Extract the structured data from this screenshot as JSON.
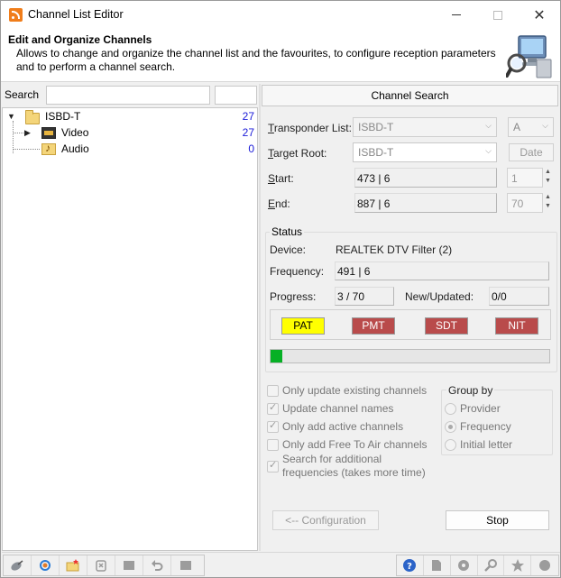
{
  "window": {
    "title": "Channel List Editor",
    "minimize_glyph": "",
    "close_glyph": "✕"
  },
  "header": {
    "title": "Edit and Organize Channels",
    "description": "Allows to change and organize the channel list and the favourites, to configure reception parameters and to perform a channel search.",
    "logo_icon": "computer-search-icon"
  },
  "left": {
    "search_label": "Search",
    "search_value": "",
    "tree": {
      "root": {
        "label": "ISBD-T",
        "count": "27",
        "icon": "folder-open-icon"
      },
      "children": [
        {
          "label": "Video",
          "count": "27",
          "icon": "film-icon"
        },
        {
          "label": "Audio",
          "count": "0",
          "icon": "audio-folder-icon"
        }
      ]
    }
  },
  "channel_search": {
    "header": "Channel Search",
    "transponder_list_label": "Transponder List:",
    "transponder_list_value": "ISBD-T",
    "transponder_list_suffix_value": "A",
    "target_root_label": "Target Root:",
    "target_root_value": "ISBD-T",
    "date_button": "Date",
    "start_label": "Start:",
    "start_value": "473 | 6",
    "start_spin": "1",
    "end_label": "End:",
    "end_value": "887 | 6",
    "end_spin": "70"
  },
  "status": {
    "title": "Status",
    "device_label": "Device:",
    "device_value": "REALTEK DTV Filter (2)",
    "frequency_label": "Frequency:",
    "frequency_value": "491 | 6",
    "progress_label": "Progress:",
    "progress_value": "3 / 70",
    "new_updated_label": "New/Updated:",
    "new_updated_value": "0/0",
    "tables": [
      {
        "label": "PAT",
        "bg": "#ffff00",
        "fg": "#000000"
      },
      {
        "label": "PMT",
        "bg": "#b94b4b",
        "fg": "#ffffff"
      },
      {
        "label": "SDT",
        "bg": "#b94b4b",
        "fg": "#ffffff"
      },
      {
        "label": "NIT",
        "bg": "#b94b4b",
        "fg": "#ffffff"
      }
    ],
    "progress_fraction": 0.0429,
    "progress_color": "#06b025"
  },
  "options": {
    "checkboxes": [
      {
        "label": "Only update existing channels",
        "checked": false
      },
      {
        "label": "Update channel names",
        "checked": true
      },
      {
        "label": "Only add active channels",
        "checked": true
      },
      {
        "label": "Only add Free To Air channels",
        "checked": false
      },
      {
        "label": "Search for additional",
        "label2": "frequencies (takes more time)",
        "checked": true
      }
    ],
    "group_by_title": "Group by",
    "group_by": [
      {
        "label": "Provider",
        "checked": false
      },
      {
        "label": "Frequency",
        "checked": true
      },
      {
        "label": "Initial letter",
        "checked": false
      }
    ]
  },
  "buttons": {
    "configuration": "<-- Configuration",
    "stop": "Stop"
  },
  "toolbar": {
    "left_icons": [
      "satellite-icon",
      "refresh-icon",
      "new-folder-icon",
      "delete-icon",
      "box-icon",
      "undo-icon",
      "box2-icon"
    ],
    "right_icons": [
      "help-icon",
      "document-icon",
      "gear-icon",
      "search-icon",
      "star-icon",
      "circle-icon"
    ]
  }
}
